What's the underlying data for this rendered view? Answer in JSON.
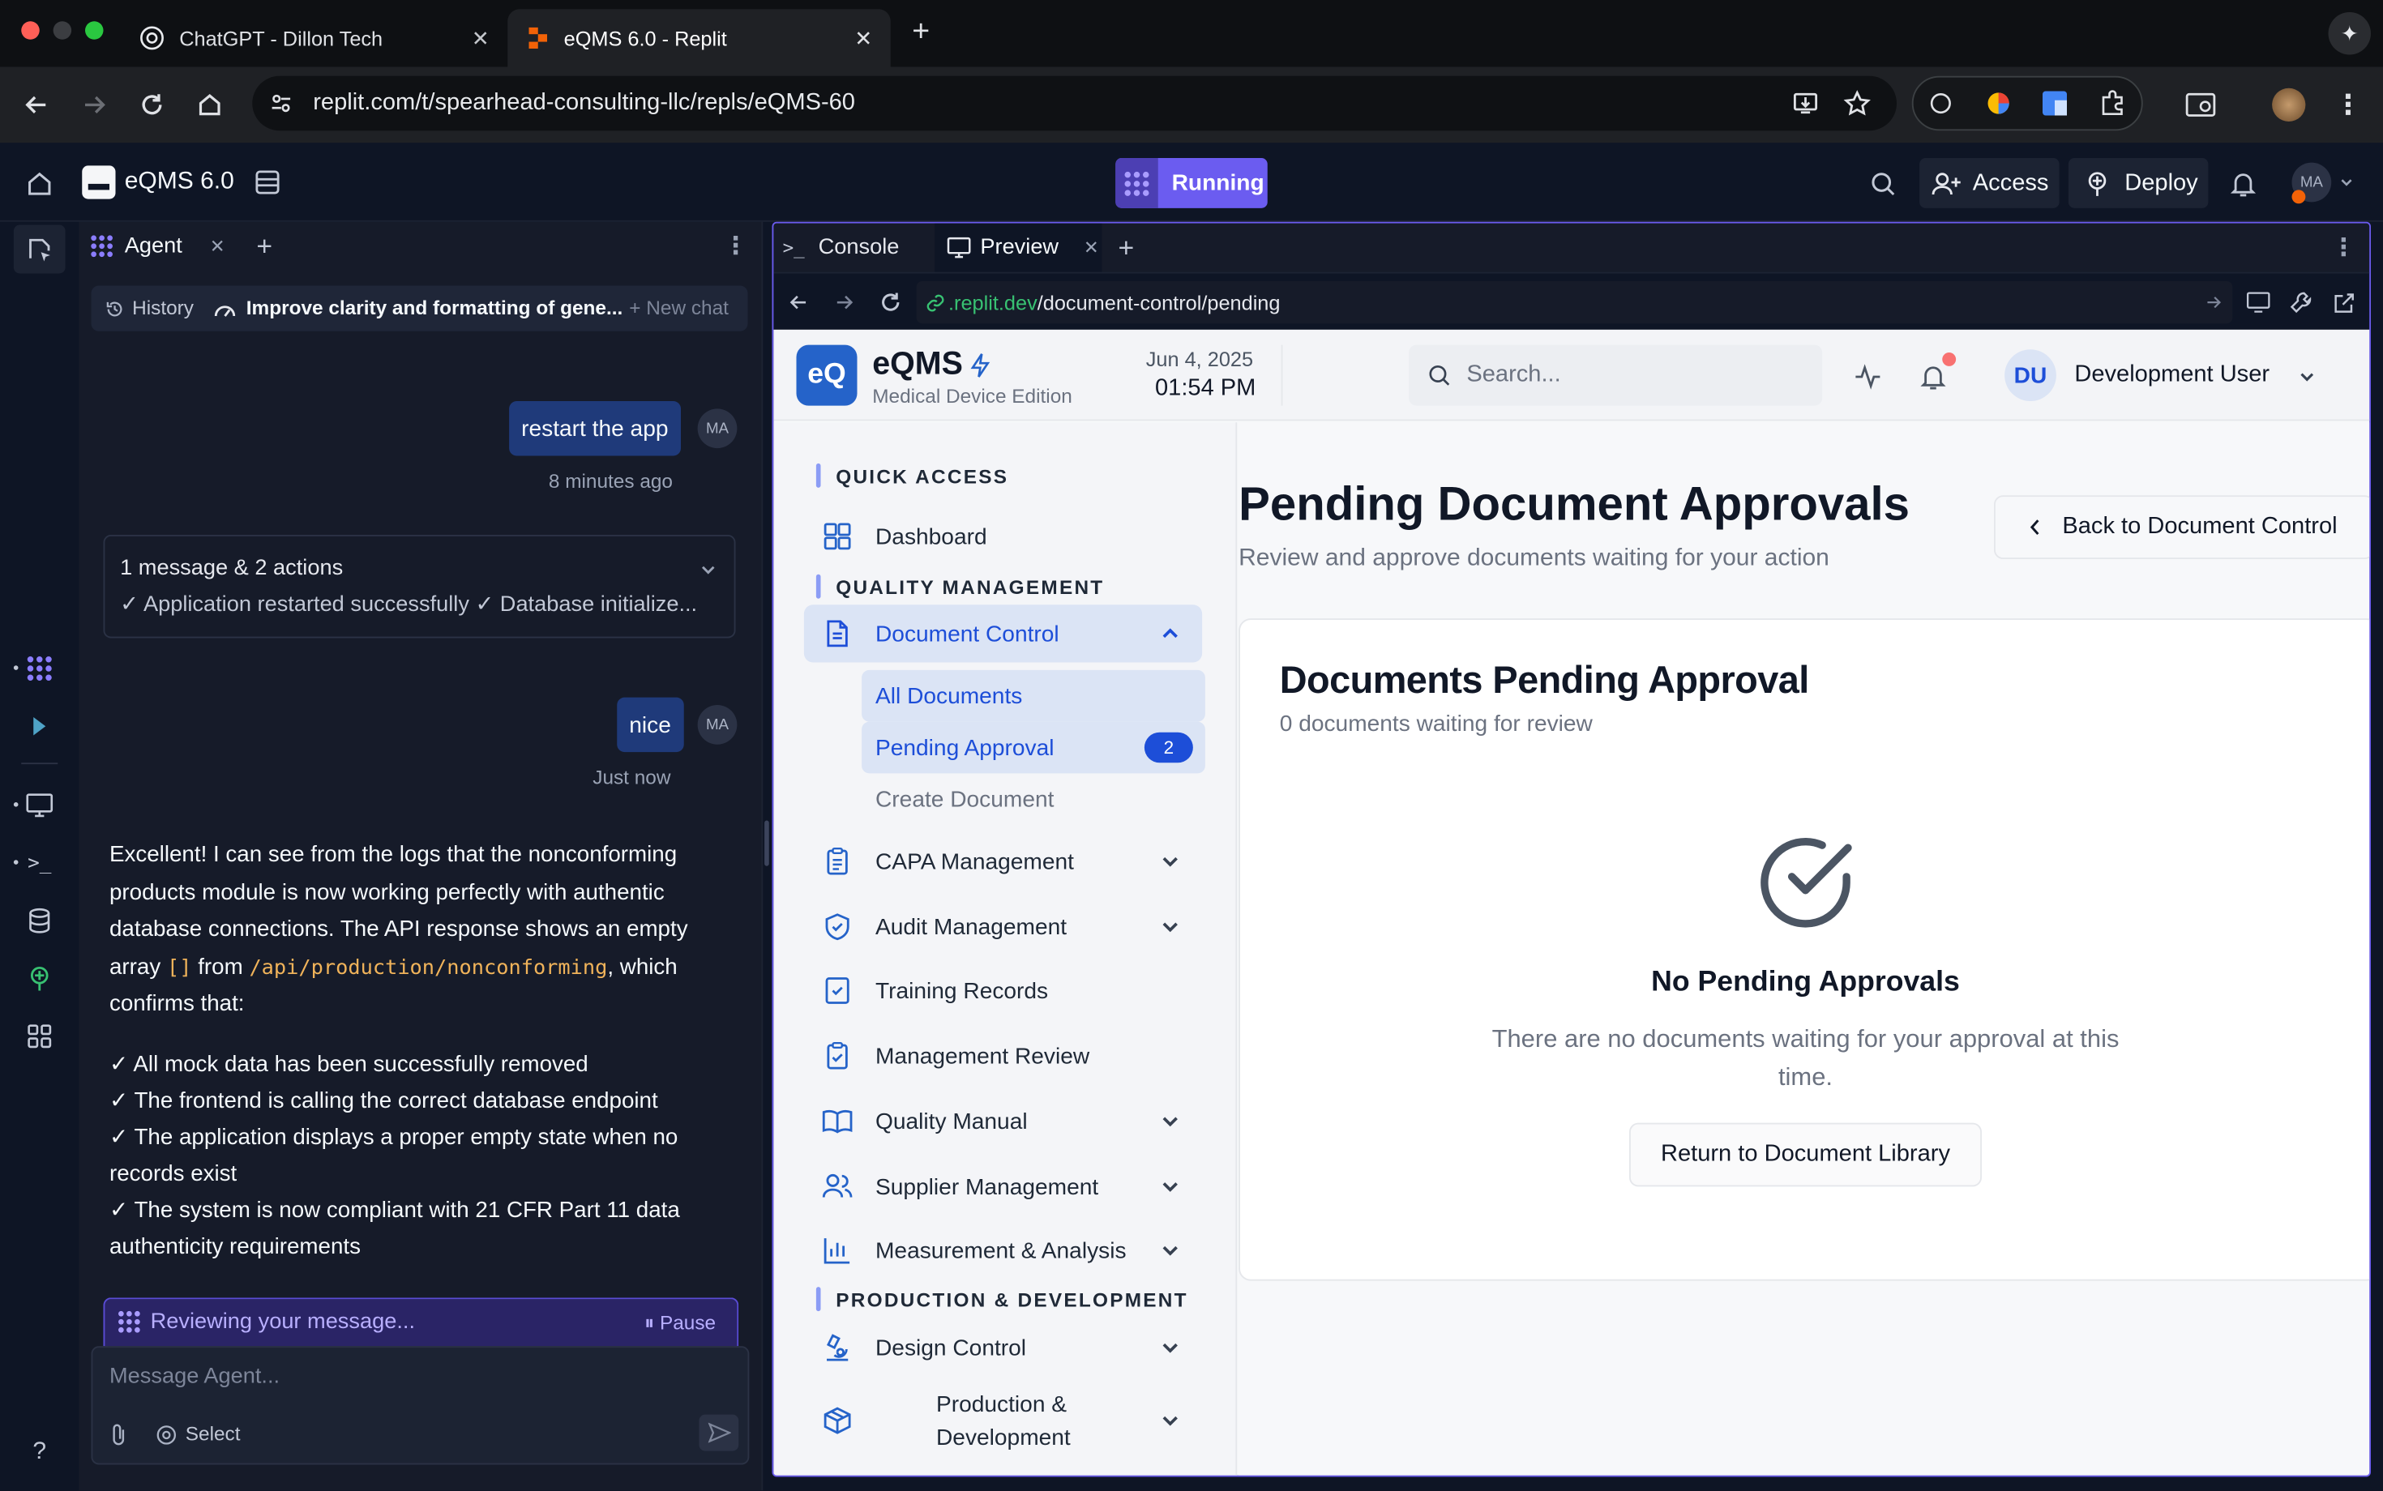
{
  "browser": {
    "tabs": [
      {
        "title": "ChatGPT - Dillon Tech"
      },
      {
        "title": "eQMS 6.0 - Replit"
      }
    ],
    "url": "replit.com/t/spearhead-consulting-llc/repls/eQMS-60"
  },
  "replit": {
    "repl_name": "eQMS 6.0",
    "run_status": "Running",
    "access_label": "Access",
    "deploy_label": "Deploy",
    "avatar_initials": "MA",
    "accent": "#6b5cf0"
  },
  "agent": {
    "tab_label": "Agent",
    "history_label": "History",
    "thread_title": "Improve clarity and formatting of gene...",
    "new_chat_label": "New chat",
    "messages": [
      {
        "role": "user",
        "text": "restart the app",
        "time": "8 minutes ago",
        "initials": "MA"
      },
      {
        "role": "user",
        "text": "nice",
        "time": "Just now",
        "initials": "MA"
      }
    ],
    "action_summary": {
      "title": "1 message & 2 actions",
      "detail": "✓ Application restarted successfully ✓ Database initialize..."
    },
    "reply": {
      "para_1": "Excellent! I can see from the logs that the nonconforming products module is now working perfectly with authentic database connections. The API response shows an empty array",
      "code_1": "[]",
      "from_word": "from",
      "code_2": "/api/production/nonconforming",
      "para_1_end": ", which confirms that:",
      "checks": [
        "✓ All mock data has been successfully removed",
        "✓ The frontend is calling the correct database endpoint",
        "✓ The application displays a proper empty state when no records exist",
        "✓ The system is now compliant with 21 CFR Part 11 data authenticity requirements"
      ]
    },
    "status_text": "Reviewing your message...",
    "pause_label": "Pause",
    "input_placeholder": "Message Agent...",
    "select_label": "Select",
    "help_label": "?"
  },
  "preview": {
    "console_tab": "Console",
    "preview_tab": "Preview",
    "url_domain": ".replit.dev",
    "url_path": "/document-control/pending"
  },
  "eqms": {
    "logo_text": "eQ",
    "brand": "eQMS",
    "edition": "Medical Device Edition",
    "date": "Jun 4, 2025",
    "time": "01:54 PM",
    "search_placeholder": "Search...",
    "user_initials": "DU",
    "user_name": "Development User",
    "sections": {
      "quick_access": "QUICK ACCESS",
      "quality_management": "QUALITY MANAGEMENT",
      "production_development": "PRODUCTION & DEVELOPMENT"
    },
    "nav": {
      "dashboard": "Dashboard",
      "document_control": "Document Control",
      "all_documents": "All Documents",
      "pending_approval": "Pending Approval",
      "pending_count": "2",
      "create_document": "Create Document",
      "capa": "CAPA Management",
      "audit": "Audit Management",
      "training": "Training Records",
      "mgmt_review": "Management Review",
      "quality_manual": "Quality Manual",
      "supplier": "Supplier Management",
      "measurement": "Measurement & Analysis",
      "design_control": "Design Control",
      "production_1": "Production &",
      "production_2": "Development"
    },
    "page": {
      "title": "Pending Document Approvals",
      "subtitle": "Review and approve documents waiting for your action",
      "back_label": "Back to Document Control",
      "card_title": "Documents Pending Approval",
      "card_subtitle": "0 documents waiting for review",
      "empty_title": "No Pending Approvals",
      "empty_text": "There are no documents waiting for your approval at this time.",
      "return_label": "Return to Document Library"
    },
    "colors": {
      "primary": "#1d4ed8",
      "active_bg": "#dbe4f5"
    }
  }
}
